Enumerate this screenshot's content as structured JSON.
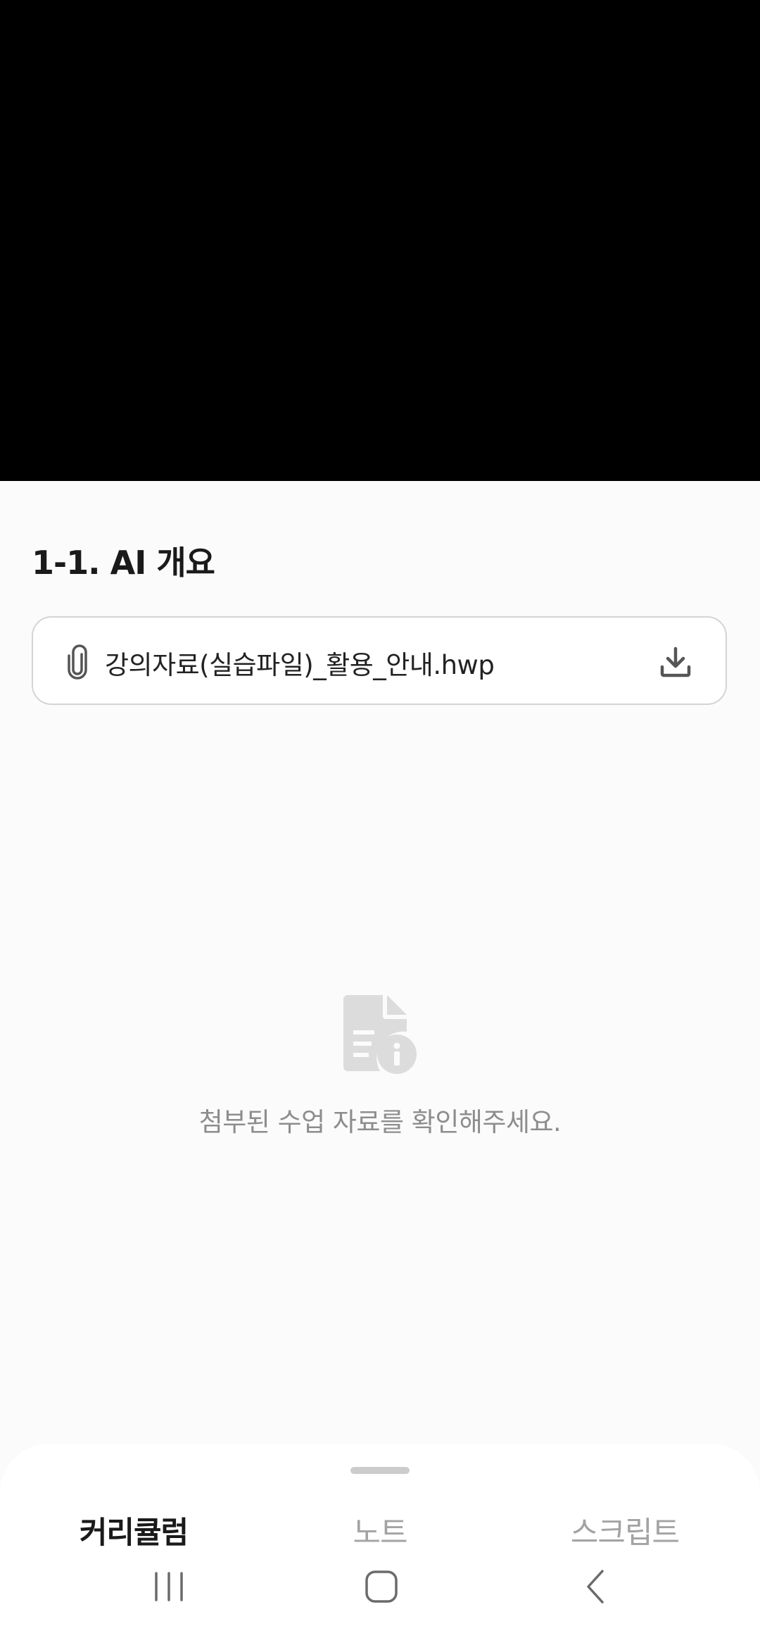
{
  "video_player": {
    "state": "black"
  },
  "lecture": {
    "title": "1-1. AI 개요"
  },
  "attachment": {
    "file_name": "강의자료(실습파일)_활용_안내.hwp",
    "leading_icon": "paperclip-icon",
    "trailing_icon": "download-icon"
  },
  "empty_state": {
    "icon": "document-info-icon",
    "message": "첨부된 수업 자료를 확인해주세요."
  },
  "bottom_tabs": {
    "items": [
      {
        "label": "커리큘럼",
        "active": true
      },
      {
        "label": "노트",
        "active": false
      },
      {
        "label": "스크립트",
        "active": false
      }
    ]
  },
  "system_nav": {
    "buttons": [
      "recents-icon",
      "home-icon",
      "back-icon"
    ]
  },
  "colors": {
    "background": "#fbfbfb",
    "video_background": "#000000",
    "border": "#d4d4d4",
    "muted_text": "#8d8d8d",
    "inactive_tab": "#a3a3a3",
    "icon_gray": "#dcdcdc"
  }
}
